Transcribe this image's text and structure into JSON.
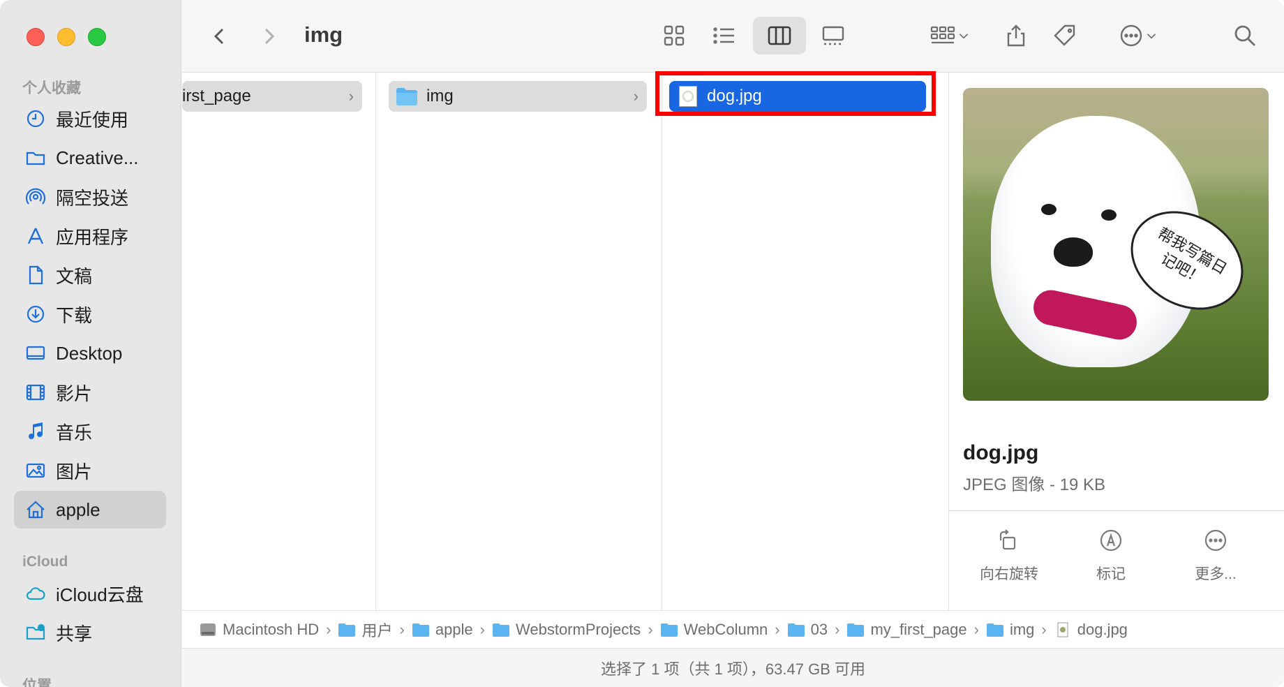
{
  "window": {
    "title": "img"
  },
  "sidebar": {
    "favorites_header": "个人收藏",
    "items": [
      {
        "label": "最近使用",
        "icon": "clock-icon"
      },
      {
        "label": "Creative...",
        "icon": "folder-icon"
      },
      {
        "label": "隔空投送",
        "icon": "airdrop-icon"
      },
      {
        "label": "应用程序",
        "icon": "applications-icon"
      },
      {
        "label": "文稿",
        "icon": "document-icon"
      },
      {
        "label": "下载",
        "icon": "download-icon"
      },
      {
        "label": "Desktop",
        "icon": "desktop-icon"
      },
      {
        "label": "影片",
        "icon": "film-icon"
      },
      {
        "label": "音乐",
        "icon": "music-icon"
      },
      {
        "label": "图片",
        "icon": "photo-icon"
      },
      {
        "label": "apple",
        "icon": "home-icon"
      }
    ],
    "icloud_header": "iCloud",
    "icloud_items": [
      {
        "label": "iCloud云盘",
        "icon": "cloud-icon"
      },
      {
        "label": "共享",
        "icon": "shared-folder-icon"
      }
    ],
    "locations_header": "位置"
  },
  "columns": {
    "col1_item": "irst_page",
    "col2_item": "img",
    "col3_item": "dog.jpg"
  },
  "preview": {
    "name": "dog.jpg",
    "kind": "JPEG 图像 - 19 KB",
    "bubble_text": "帮我写篇日记吧！",
    "actions": {
      "rotate": "向右旋转",
      "markup": "标记",
      "more": "更多..."
    }
  },
  "pathbar": {
    "items": [
      "Macintosh HD",
      "用户",
      "apple",
      "WebstormProjects",
      "WebColumn",
      "03",
      "my_first_page",
      "img",
      "dog.jpg"
    ]
  },
  "status": {
    "text": "选择了 1 项（共 1 项），63.47 GB 可用"
  },
  "colors": {
    "selection": "#1866e1",
    "highlight_box": "#ff0000",
    "sidebar_accent": "#1e6fde"
  }
}
